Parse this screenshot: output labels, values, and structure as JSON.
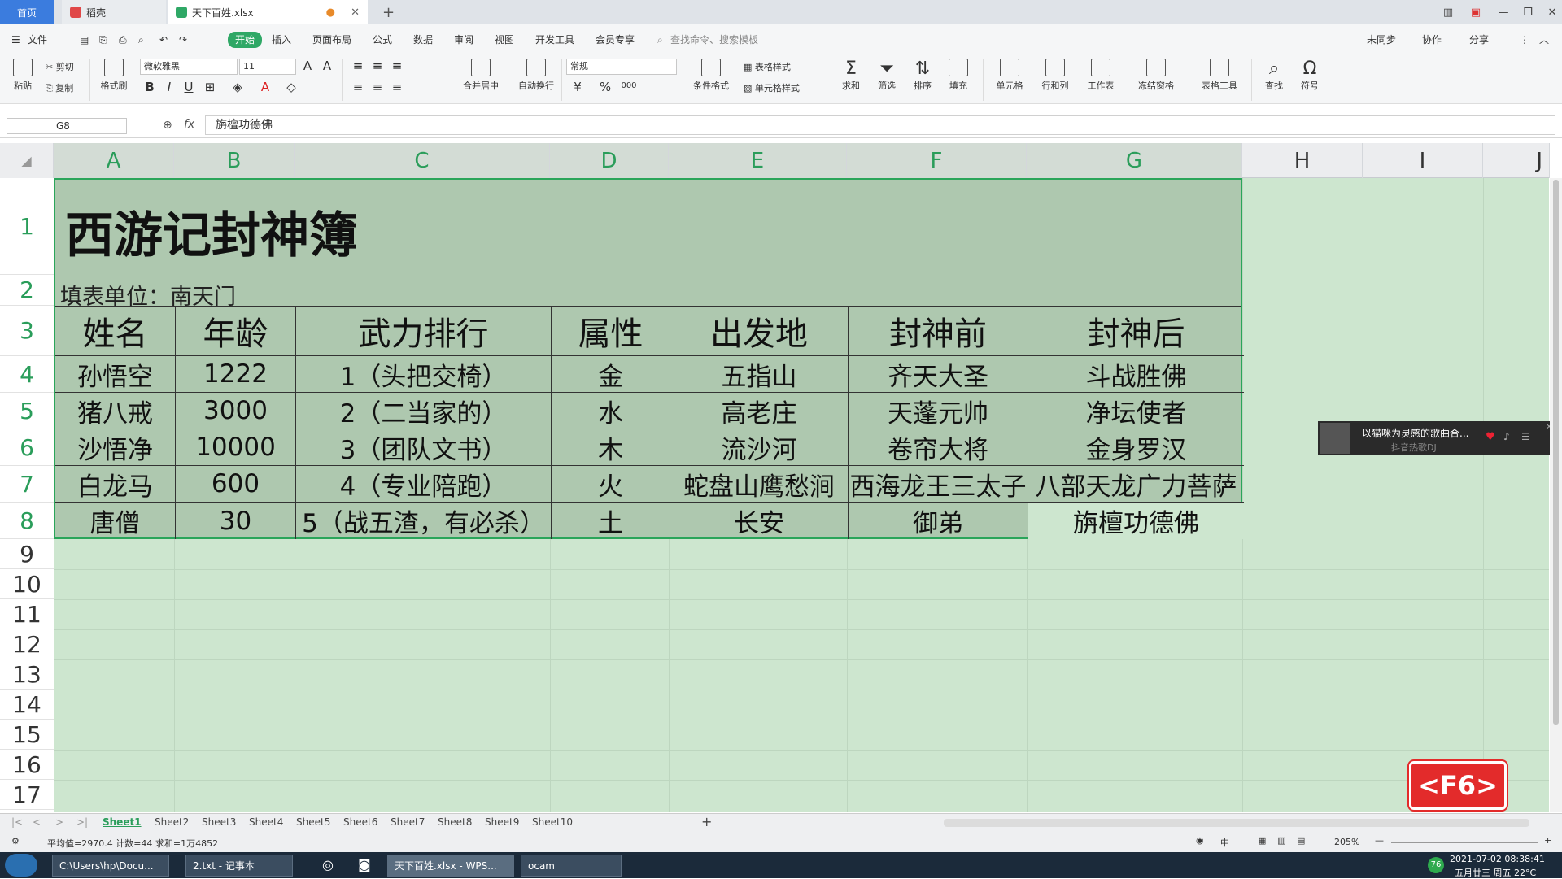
{
  "tabs": {
    "home": "首页",
    "daoke": "稻壳",
    "file": "天下百姓.xlsx",
    "new_tab": "+"
  },
  "menu": {
    "file": "文件",
    "start": "开始",
    "insert": "插入",
    "layout": "页面布局",
    "formula": "公式",
    "data": "数据",
    "review": "审阅",
    "view": "视图",
    "dev": "开发工具",
    "member": "会员专享",
    "search": "查找命令、搜索模板",
    "sync": "未同步",
    "collab": "协作",
    "share": "分享"
  },
  "ribbon": {
    "paste": "粘贴",
    "cut": "剪切",
    "copy": "复制",
    "format_painter": "格式刷",
    "font_name": "微软雅黑",
    "font_size": "11",
    "merge": "合并居中",
    "wrap": "自动换行",
    "number_format": "常规",
    "currency": "¥",
    "percent": "%",
    "thousands": "000",
    "cond_format": "条件格式",
    "table_style": "表格样式",
    "cell_style": "单元格样式",
    "sum": "求和",
    "filter": "筛选",
    "sort": "排序",
    "fill": "填充",
    "cell": "单元格",
    "rowcol": "行和列",
    "worksheet": "工作表",
    "freeze": "冻结窗格",
    "table_tools": "表格工具",
    "find": "查找",
    "symbol": "符号"
  },
  "formula_bar": {
    "cell_ref": "G8",
    "fx": "fx",
    "content": "旃檀功德佛"
  },
  "columns": [
    "A",
    "B",
    "C",
    "D",
    "E",
    "F",
    "G",
    "H",
    "I",
    "J"
  ],
  "rows": [
    "1",
    "2",
    "3",
    "4",
    "5",
    "6",
    "7",
    "8",
    "9",
    "10",
    "11",
    "12",
    "13",
    "14",
    "15",
    "16",
    "17"
  ],
  "sheet": {
    "title": "西游记封神簿",
    "unit": "填表单位：南天门",
    "headers": [
      "姓名",
      "年龄",
      "武力排行",
      "属性",
      "出发地",
      "封神前",
      "封神后"
    ],
    "data": [
      [
        "孙悟空",
        "1222",
        "1（头把交椅）",
        "金",
        "五指山",
        "齐天大圣",
        "斗战胜佛"
      ],
      [
        "猪八戒",
        "3000",
        "2（二当家的）",
        "水",
        "高老庄",
        "天蓬元帅",
        "净坛使者"
      ],
      [
        "沙悟净",
        "10000",
        "3（团队文书）",
        "木",
        "流沙河",
        "卷帘大将",
        "金身罗汉"
      ],
      [
        "白龙马",
        "600",
        "4（专业陪跑）",
        "火",
        "蛇盘山鹰愁涧",
        "西海龙王三太子",
        "八部天龙广力菩萨"
      ],
      [
        "唐僧",
        "30",
        "5（战五渣，有必杀）",
        "土",
        "长安",
        "御弟",
        "旃檀功德佛"
      ]
    ]
  },
  "music_popup": {
    "title": "以猫咪为灵感的歌曲合...",
    "subtitle": "抖音热歌DJ"
  },
  "f6_badge": "<F6>",
  "sheet_tabs": [
    "Sheet1",
    "Sheet2",
    "Sheet3",
    "Sheet4",
    "Sheet5",
    "Sheet6",
    "Sheet7",
    "Sheet8",
    "Sheet9",
    "Sheet10"
  ],
  "status": {
    "stats": "平均值=2970.4  计数=44  求和=1万4852",
    "zoom": "205%"
  },
  "taskbar": {
    "items": [
      "C:\\Users\\hp\\Docu...",
      "2.txt - 记事本",
      "天下百姓.xlsx - WPS...",
      "ocam"
    ],
    "badge": "76",
    "datetime": "2021-07-02 08:38:41",
    "date2": "五月廿三 周五 22°C"
  },
  "colors": {
    "accent": "#2fa866",
    "sheet_bg": "#cde6cf",
    "selection_bg": "#aec8af"
  }
}
